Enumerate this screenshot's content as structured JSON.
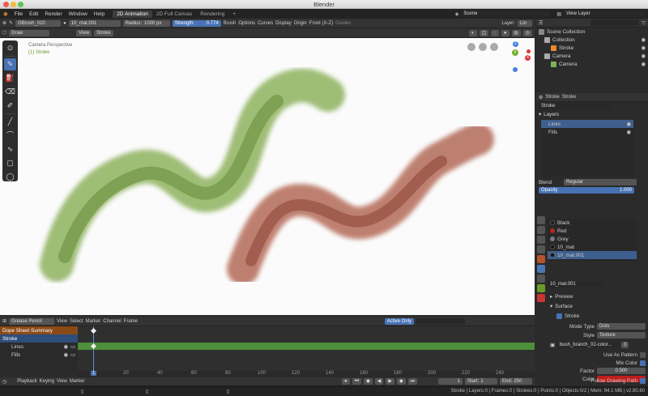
{
  "window": {
    "title": "Blender"
  },
  "menu": {
    "items": [
      "File",
      "Edit",
      "Render",
      "Window",
      "Help"
    ],
    "workspaces": [
      "2D Animation",
      "2D Full Canvas",
      "Rendering"
    ],
    "add_tab": "+",
    "scene": "Scene",
    "view_layer": "View Layer"
  },
  "tool_header": {
    "mode": "Draw",
    "brush": "GBrush_010",
    "material": "10_mat.001",
    "radius_label": "Radius:",
    "radius_value": "1000 px",
    "strength_label": "Strength:",
    "strength_value": "0.774",
    "brush_menu": "Brush",
    "options_menu": "Options",
    "curves_menu": "Curves",
    "display_menu": "Display",
    "origin": "Origin",
    "view": "Front (X-Z)",
    "guides": "Guides",
    "layer_label": "Layer:",
    "layer_value": "Lin"
  },
  "viewport_header": {
    "view": "View",
    "stroke": "Stroke"
  },
  "viewport": {
    "camera_text": "Camera Perspective",
    "object_text": "(1) Stroke",
    "axis_x": "X",
    "axis_y": "Y",
    "axis_z": "Z"
  },
  "outliner": {
    "rows": [
      "Scene Collection",
      "Collection",
      "Stroke",
      "Camera",
      "Camera"
    ]
  },
  "properties": {
    "object_tab": "Stroke",
    "data_tab": "Stroke",
    "data_name": "Stroke",
    "layers_title": "Layers",
    "layers": [
      "Lines",
      "Fills"
    ],
    "blend_label": "Blend",
    "blend_value": "Regular",
    "opacity_label": "Opacity",
    "opacity_value": "1.000",
    "materials": [
      {
        "name": "Black",
        "color": "#1a1a1a"
      },
      {
        "name": "Red",
        "color": "#b3261e"
      },
      {
        "name": "Grey",
        "color": "#7a7a7a"
      },
      {
        "name": "10_mat",
        "color": "#111111"
      },
      {
        "name": "10_mat.001",
        "color": "#111111"
      }
    ],
    "mat_field": "10_mat.001",
    "preview": "Preview",
    "surface": "Surface",
    "stroke_sub": "Stroke",
    "mode_type_label": "Mode Type",
    "mode_type_value": "Dots",
    "style_label": "Style",
    "style_value": "Texture",
    "texture": "bush_branch_02-color...",
    "texture_users": "3",
    "use_as_pattern": "Use As Pattern",
    "mix_color": "Mix Color",
    "factor_label": "Factor",
    "factor_value": "0.500",
    "color_label": "Color",
    "follow_path": "Follow Drawing Path",
    "swatch": "#c11d1d"
  },
  "dopesheet": {
    "editor": "Grease Pencil",
    "menus": [
      "View",
      "Select",
      "Marker",
      "Channel",
      "Frame"
    ],
    "active_only": "Active Only",
    "summary": "Dope Sheet Summary",
    "object": "Stroke",
    "channels": [
      "Lines",
      "Fills"
    ],
    "ruler": [
      "1",
      "20",
      "40",
      "60",
      "80",
      "100",
      "120",
      "140",
      "160",
      "180",
      "200",
      "220",
      "240"
    ],
    "current_frame": "1"
  },
  "playback": {
    "playback": "Playback",
    "keying": "Keying",
    "view": "View",
    "marker": "Marker",
    "frame": "1",
    "start_label": "Start:",
    "start": "1",
    "end_label": "End:",
    "end": "250"
  },
  "status": {
    "text": "Stroke | Layers:0 | Frames:0 | Strokes:0 | Points:0 | Objects:0/2 | Mem: 94.1 MB | v2.80.60"
  },
  "colors": {
    "accent": "#4772b3",
    "green_strokes": "#6a9a2a",
    "red_strokes": "#9b3a22",
    "timeline_green": "#4e8f3a"
  }
}
